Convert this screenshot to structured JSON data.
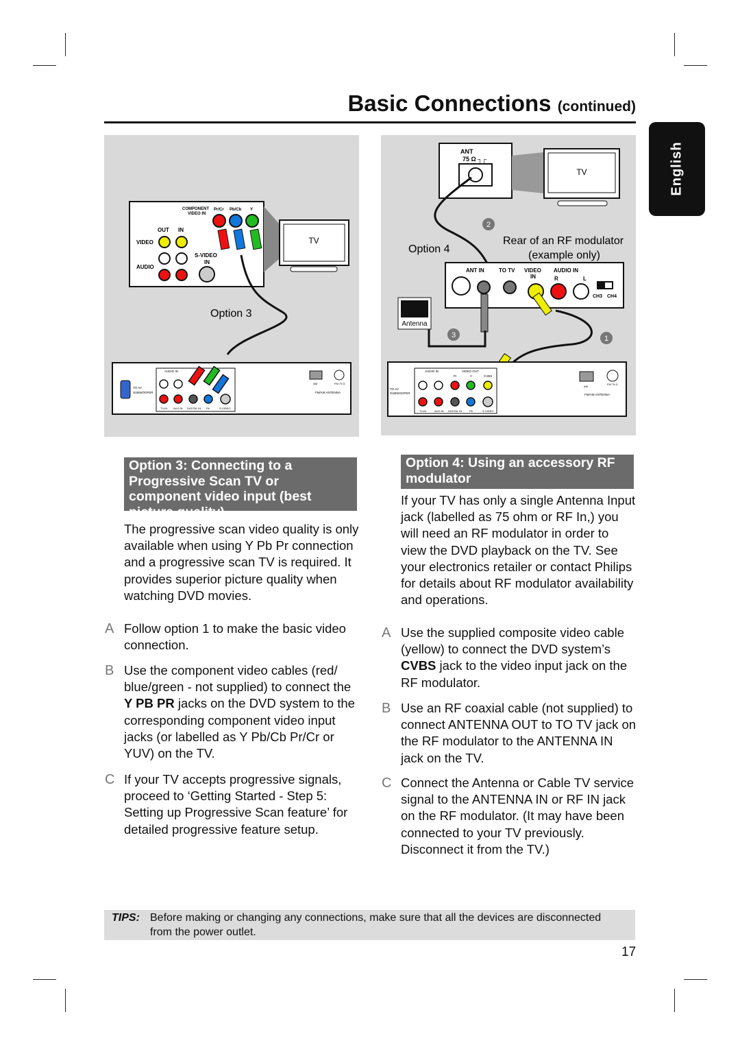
{
  "header": {
    "title": "Basic Connections",
    "title_suffix": "(continued)"
  },
  "language_tab": "English",
  "diagram3": {
    "tv": "TV",
    "component": "COMPONENT",
    "video_in": "VIDEO IN",
    "prcr": "Pr/Cr",
    "pbcb": "Pb/Cb",
    "y": "Y",
    "out": "OUT",
    "in": "IN",
    "video": "VIDEO",
    "audio": "AUDIO",
    "svideo": "S-VIDEO",
    "svideo_in": "IN",
    "option": "Option 3",
    "audio_in": "AUDIO IN",
    "to_av": "TO AV",
    "subwoofer": "SUBWOOFER",
    "tvin": "TV-IN",
    "auxin": "AUX-IN",
    "digital": "DIGITAL IN",
    "pb": "Pb",
    "svideo2": "S-VIDEO",
    "am": "AM",
    "fm": "FM 75 Ω",
    "fmam": "FM/AM ANTENNA"
  },
  "diagram4": {
    "ant": "ANT",
    "ohm": "75 Ω ┐┌",
    "tv": "TV",
    "option": "Option 4",
    "rear1": "Rear of an RF modulator",
    "rear2": "(example only)",
    "ant_in": "ANT IN",
    "to_tv": "TO TV",
    "video": "VIDEO",
    "video_in": "IN",
    "audio_in": "AUDIO  IN",
    "r": "R",
    "l": "L",
    "ch3": "CH3",
    "ch4": "CH4",
    "antenna": "Antenna",
    "n1": "1",
    "n2": "2",
    "n3": "3",
    "audio_in2": "AUDIO IN",
    "video_out": "VIDEO OUT",
    "pr": "Pr",
    "y": "Y",
    "cvbs": "CVBS",
    "to_av": "TO AV",
    "subwoofer": "SUBWOOFER",
    "tvin": "TV-IN",
    "auxin": "AUX-IN",
    "digital": "DIGITAL IN",
    "pb": "Pb",
    "svideo": "S-VIDEO",
    "am": "AM",
    "fm": "FM 75 Ω",
    "fmam": "FM/AM  ANTENNA"
  },
  "option3": {
    "heading": "Option 3: Connecting to a Progressive Scan TV or component video input (best picture quality)",
    "intro": "The progressive scan video quality is only available when using Y Pb Pr connection and a progressive scan TV is required. It provides superior picture quality when watching DVD movies.",
    "steps": [
      {
        "letter": "A",
        "text": "Follow option 1 to make the basic video connection."
      },
      {
        "letter": "B",
        "pre": "Use the component video cables (red/ blue/green - not supplied) to connect the ",
        "bold": "Y PB PR",
        "post": " jacks on the DVD system to the corresponding component video input jacks (or labelled as Y Pb/Cb Pr/Cr or YUV) on the TV."
      },
      {
        "letter": "C",
        "text": "If your TV accepts progressive signals, proceed to ‘Getting Started - Step 5: Setting up Progressive Scan feature’ for detailed progressive feature setup."
      }
    ]
  },
  "option4": {
    "heading": "Option 4: Using an accessory RF modulator",
    "intro": "If your TV has only a single Antenna Input jack (labelled as 75 ohm or RF In,) you will need an RF modulator in order to view the DVD playback on the TV.  See your electronics retailer or contact Philips for details about RF modulator availability and operations.",
    "steps": [
      {
        "letter": "A",
        "pre": "Use the supplied composite video cable (yellow) to connect the DVD system’s ",
        "bold": "CVBS",
        "post": " jack to the video input jack on the RF modulator."
      },
      {
        "letter": "B",
        "text": "Use an RF coaxial cable (not supplied) to connect ANTENNA OUT to TO TV jack on the RF modulator to the ANTENNA IN jack on the TV."
      },
      {
        "letter": "C",
        "text": "Connect the Antenna or Cable TV service signal to the ANTENNA IN or RF IN jack on the RF modulator.  (It may have  been connected to your TV previously.  Disconnect it from the TV.)"
      }
    ]
  },
  "tips": {
    "label": "TIPS:",
    "line1": "Before making or changing any connections, make sure that all the devices are disconnected",
    "line2": "from the power outlet."
  },
  "page_number": "17"
}
